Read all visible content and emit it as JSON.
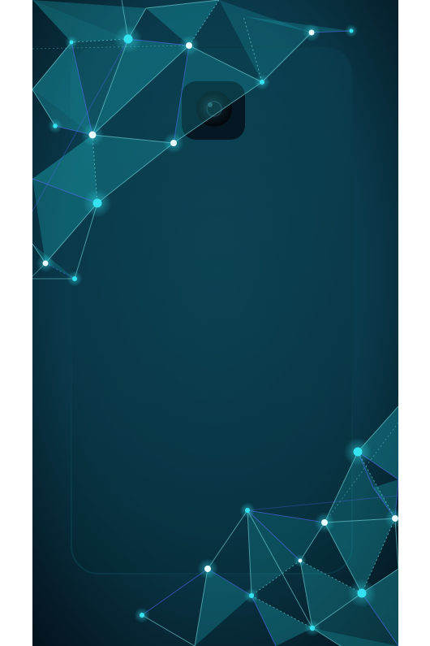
{
  "image": {
    "description_free": true
  },
  "palette": {
    "page_background": "#ffffff",
    "backdrop_dark": "#04141f",
    "backdrop_mid": "#0a3a4b",
    "backdrop_glow": "#0e4c5e",
    "facet_teal": "#1fb9c4",
    "line_cyan": "#7fe6ea",
    "line_violet": "#5a6bff",
    "node_white": "#e8fbff",
    "node_cyan": "#35e3f0",
    "phone_outline": "#0b3a48",
    "camera_black": "#050b10"
  },
  "icons": {
    "camera": "camera-lens-icon"
  }
}
